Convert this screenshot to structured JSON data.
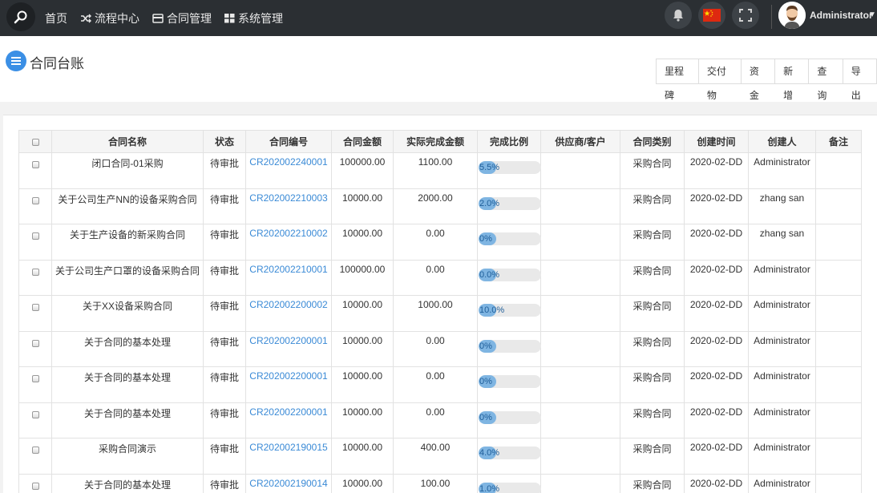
{
  "nav": {
    "items": [
      {
        "label": "首页",
        "icon": "home"
      },
      {
        "label": "流程中心",
        "icon": "shuffle-icon"
      },
      {
        "label": "合同管理",
        "icon": "card-icon"
      },
      {
        "label": "系统管理",
        "icon": "grid-icon"
      }
    ],
    "user": "Administrator"
  },
  "page": {
    "title": "合同台账",
    "toolbar": [
      "里程碑",
      "交付物",
      "资金",
      "新增",
      "查询",
      "导出"
    ]
  },
  "table": {
    "columns": [
      "",
      "合同名称",
      "状态",
      "合同编号",
      "合同金额",
      "实际完成金额",
      "完成比例",
      "供应商/客户",
      "合同类别",
      "创建时间",
      "创建人",
      "备注"
    ],
    "rows": [
      {
        "name": "闭口合同-01采购",
        "status": "待审批",
        "code": "CR202002240001",
        "amount": "100000.00",
        "actual": "1100.00",
        "ratio": 0.055,
        "ratio_text": "5.5%",
        "supplier": "",
        "type": "采购合同",
        "date": "2020-02-DD",
        "creator": "Administrator",
        "note": ""
      },
      {
        "name": "关于公司生产NN的设备采购合同",
        "status": "待审批",
        "code": "CR202002210003",
        "amount": "10000.00",
        "actual": "2000.00",
        "ratio": 0.02,
        "ratio_text": "2.0%",
        "supplier": "",
        "type": "采购合同",
        "date": "2020-02-DD",
        "creator": "zhang san",
        "note": ""
      },
      {
        "name": "关于生产设备的新采购合同",
        "status": "待审批",
        "code": "CR202002210002",
        "amount": "10000.00",
        "actual": "0.00",
        "ratio": 0,
        "ratio_text": "0%",
        "supplier": "",
        "type": "采购合同",
        "date": "2020-02-DD",
        "creator": "zhang san",
        "note": ""
      },
      {
        "name": "关于公司生产口罩的设备采购合同",
        "status": "待审批",
        "code": "CR202002210001",
        "amount": "100000.00",
        "actual": "0.00",
        "ratio": 0,
        "ratio_text": "0.0%",
        "supplier": "",
        "type": "采购合同",
        "date": "2020-02-DD",
        "creator": "Administrator",
        "note": ""
      },
      {
        "name": "关于XX设备采购合同",
        "status": "待审批",
        "code": "CR202002200002",
        "amount": "10000.00",
        "actual": "1000.00",
        "ratio": 0.1,
        "ratio_text": "10.0%",
        "supplier": "",
        "type": "采购合同",
        "date": "2020-02-DD",
        "creator": "Administrator",
        "note": ""
      },
      {
        "name": "关于合同的基本处理",
        "status": "待审批",
        "code": "CR202002200001",
        "amount": "10000.00",
        "actual": "0.00",
        "ratio": 0,
        "ratio_text": "0%",
        "supplier": "",
        "type": "采购合同",
        "date": "2020-02-DD",
        "creator": "Administrator",
        "note": ""
      },
      {
        "name": "关于合同的基本处理",
        "status": "待审批",
        "code": "CR202002200001",
        "amount": "10000.00",
        "actual": "0.00",
        "ratio": 0,
        "ratio_text": "0%",
        "supplier": "",
        "type": "采购合同",
        "date": "2020-02-DD",
        "creator": "Administrator",
        "note": ""
      },
      {
        "name": "关于合同的基本处理",
        "status": "待审批",
        "code": "CR202002200001",
        "amount": "10000.00",
        "actual": "0.00",
        "ratio": 0,
        "ratio_text": "0%",
        "supplier": "",
        "type": "采购合同",
        "date": "2020-02-DD",
        "creator": "Administrator",
        "note": ""
      },
      {
        "name": "采购合同演示",
        "status": "待审批",
        "code": "CR202002190015",
        "amount": "10000.00",
        "actual": "400.00",
        "ratio": 0.04,
        "ratio_text": "4.0%",
        "supplier": "",
        "type": "采购合同",
        "date": "2020-02-DD",
        "creator": "Administrator",
        "note": ""
      },
      {
        "name": "关于合同的基本处理",
        "status": "待审批",
        "code": "CR202002190014",
        "amount": "10000.00",
        "actual": "100.00",
        "ratio": 0.01,
        "ratio_text": "1.0%",
        "supplier": "",
        "type": "采购合同",
        "date": "2020-02-DD",
        "creator": "Administrator",
        "note": ""
      }
    ]
  },
  "colors": {
    "topbar": "#2b2f33",
    "link": "#3a8ad6",
    "accent": "#3b8fe5"
  }
}
